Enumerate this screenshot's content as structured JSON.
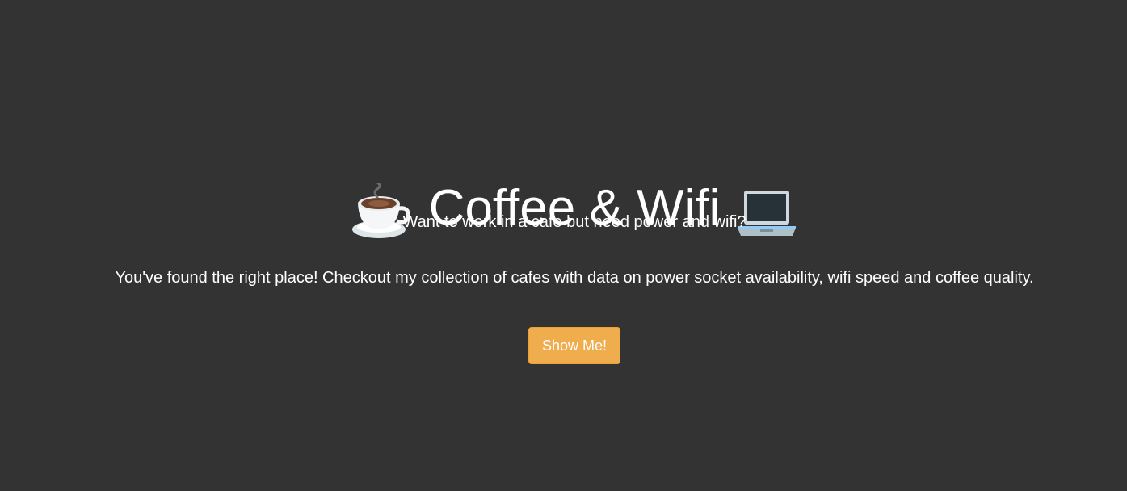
{
  "hero": {
    "title": "Coffee & Wifi",
    "title_prefix_icon": "coffee-cup-icon",
    "title_suffix_icon": "laptop-icon",
    "subtitle": "Want to work in a cafe but need power and wifi?",
    "description": "You've found the right place! Checkout my collection of cafes with data on power socket availability, wifi speed and coffee quality.",
    "button_label": "Show Me!"
  },
  "colors": {
    "background": "#333333",
    "text": "#ffffff",
    "button": "#f0ad4e"
  }
}
